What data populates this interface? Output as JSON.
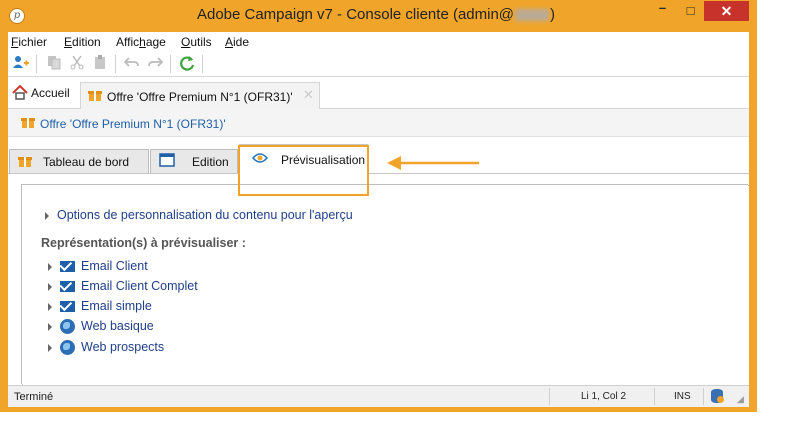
{
  "window": {
    "title_prefix": "Adobe Campaign v7 - Console cliente (admin@",
    "title_suffix": ")",
    "minimize": "–",
    "maximize": "□",
    "close": "✕"
  },
  "menubar": {
    "items": [
      {
        "underline": "F",
        "rest": "ichier"
      },
      {
        "underline": "E",
        "rest": "dition"
      },
      {
        "pre": "Affic",
        "underline": "h",
        "rest": "age"
      },
      {
        "underline": "O",
        "rest": "utils"
      },
      {
        "underline": "A",
        "rest": "ide"
      }
    ]
  },
  "toolbar": {
    "icons": [
      "add-user-icon",
      "copy-icon",
      "cut-icon",
      "paste-icon",
      "undo-icon",
      "redo-icon",
      "refresh-icon"
    ]
  },
  "doc_tabs": {
    "home": "Accueil",
    "offer": "Offre 'Offre Premium N°1 (OFR31)'",
    "close": "✕"
  },
  "breadcrumb": {
    "label": "Offre 'Offre Premium N°1 (OFR31)'"
  },
  "sub_tabs": [
    {
      "label": "Tableau de bord",
      "icon": "gift-icon"
    },
    {
      "label": "Edition",
      "icon": "window-icon"
    },
    {
      "label": "Prévisualisation",
      "icon": "eye-icon",
      "active": true
    }
  ],
  "content": {
    "options_link": "Options de personnalisation du contenu pour l'aperçu",
    "section_label": "Représentation(s) à prévisualiser :",
    "representations": [
      {
        "label": "Email Client",
        "icon": "mail-icon"
      },
      {
        "label": "Email Client Complet",
        "icon": "mail-icon"
      },
      {
        "label": "Email simple",
        "icon": "mail-icon"
      },
      {
        "label": "Web basique",
        "icon": "globe-icon"
      },
      {
        "label": "Web prospects",
        "icon": "globe-icon"
      }
    ]
  },
  "status": {
    "text": "Terminé",
    "position": "Li 1, Col 2",
    "mode": "INS"
  },
  "colors": {
    "accent": "#f0a52a",
    "link": "#1f3f8a",
    "close_button": "#c7332a"
  }
}
